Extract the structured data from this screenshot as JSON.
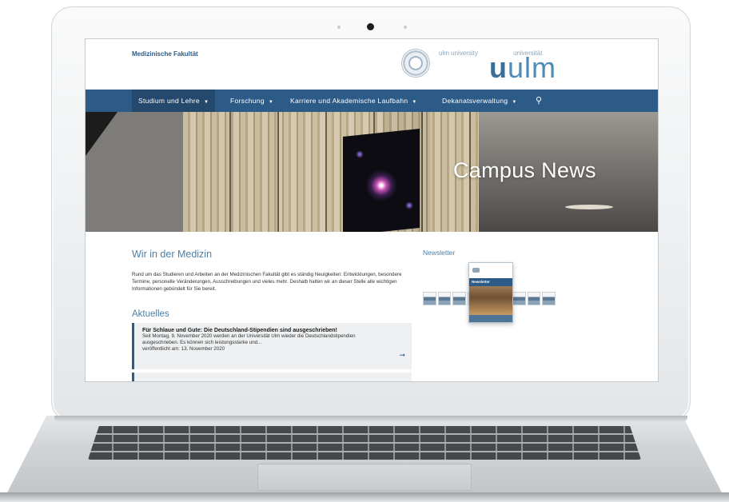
{
  "site": {
    "faculty": "Medizinische Fakultät",
    "ulm_university": "ulm university",
    "universitaet": "universität",
    "logo_prefix": "u",
    "logo_word": "ulm"
  },
  "nav": {
    "items": [
      {
        "label": "Studium und Lehre",
        "caret": "▼"
      },
      {
        "label": "Forschung",
        "caret": "▼"
      },
      {
        "label": "Karriere und Akademische Laufbahn",
        "caret": "▼"
      },
      {
        "label": "Dekanatsverwaltung",
        "caret": "▼"
      }
    ],
    "search_glyph": "⚲"
  },
  "hero": {
    "title": "Campus News"
  },
  "intro": {
    "title": "Wir in der Medizin",
    "text": "Rund um das Studieren und Arbeiten an der Medizinischen Fakultät gibt es ständig Neuigkeiten: Entwicklungen, besondere Termine, personelle Veränderungen, Ausschreibungen und vieles mehr. Deshalb halten wir an dieser Stelle alle wichtigen Informationen gebündelt für Sie bereit."
  },
  "news": {
    "title": "Aktuelles",
    "items": [
      {
        "headline": "Für Schlaue und Gute: Die Deutschland-Stipendien sind ausgeschrieben!",
        "excerpt": "Seit Montag, 9. November 2020 werden an der Universität Ulm wieder die Deutschlandstipendien ausgeschrieben. Es können sich leistungsstarke und...",
        "date": "veröffentlicht am: 13. November 2020",
        "arrow": "➞"
      }
    ]
  },
  "newsletter": {
    "title": "Newsletter",
    "cover_label": "Newsletter"
  },
  "icons": {
    "search": "search-icon",
    "caret": "chevron-down-icon",
    "arrow": "arrow-right-icon"
  },
  "colors": {
    "nav_bg": "#2c5b88",
    "accent_blue": "#4a7fa8"
  }
}
